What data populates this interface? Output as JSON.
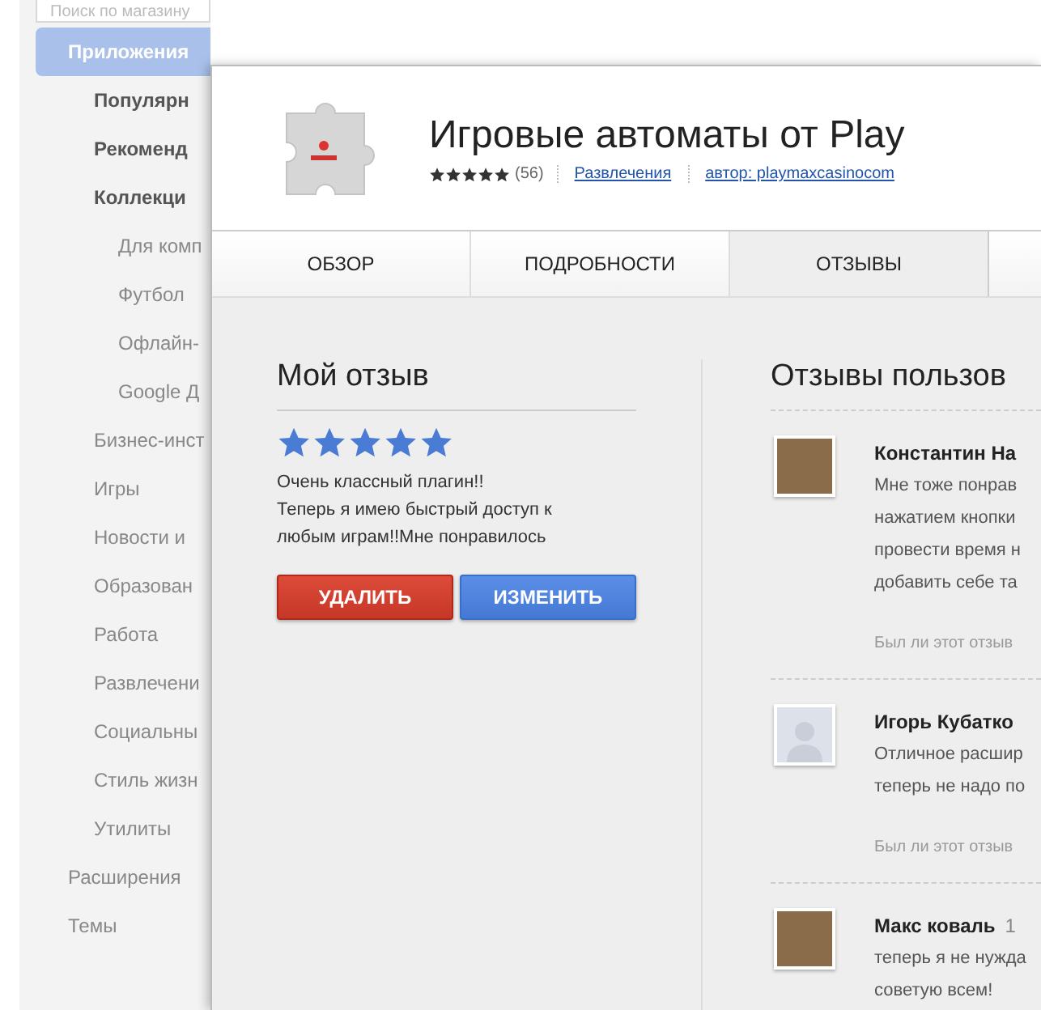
{
  "sidebar": {
    "search": {
      "placeholder": "Поиск по магазину"
    },
    "items": [
      {
        "label": "Приложения",
        "selected": true,
        "children": [
          {
            "label": "Популярн",
            "kind": "feature"
          },
          {
            "label": "Рекоменд",
            "kind": "feature"
          },
          {
            "label": "Коллекци",
            "kind": "feature",
            "children": [
              {
                "label": "Для комп"
              },
              {
                "label": "Футбол"
              },
              {
                "label": "Офлайн-"
              },
              {
                "label": "Google Д"
              }
            ]
          },
          {
            "label": "Бизнес-инст",
            "kind": "category"
          },
          {
            "label": "Игры",
            "kind": "category"
          },
          {
            "label": "Новости и",
            "kind": "category"
          },
          {
            "label": "Образован",
            "kind": "category"
          },
          {
            "label": "Работа",
            "kind": "category"
          },
          {
            "label": "Развлечени",
            "kind": "category"
          },
          {
            "label": "Социальны",
            "kind": "category"
          },
          {
            "label": "Стиль жизн",
            "kind": "category"
          },
          {
            "label": "Утилиты",
            "kind": "category"
          }
        ]
      },
      {
        "label": "Расширения",
        "selected": false
      },
      {
        "label": "Темы",
        "selected": false
      }
    ]
  },
  "dialog": {
    "title": "Игровые автоматы от Play",
    "stars": 5,
    "rating_count": "(56)",
    "category": "Развлечения",
    "author": "автор: playmaxcasinocom",
    "tabs": [
      {
        "label": "ОБЗОР",
        "selected": false
      },
      {
        "label": "ПОДРОБНОСТИ",
        "selected": false
      },
      {
        "label": "ОТЗЫВЫ",
        "selected": true
      }
    ],
    "my_review": {
      "heading": "Мой отзыв",
      "stars": 5,
      "text": [
        "Очень классный плагин!!",
        "Теперь я имею быстрый доступ к",
        "любым играм!!Мне понравилось"
      ],
      "delete_button": "УДАЛИТЬ",
      "edit_button": "ИЗМЕНИТЬ"
    },
    "user_reviews": {
      "heading": "Отзывы пользов",
      "items": [
        {
          "kind": "photo",
          "name": "Константин На",
          "lines": [
            "Мне тоже понрав",
            "нажатием кнопки",
            "провести время н",
            "добавить себе та"
          ],
          "helpful": "Был ли этот отзыв"
        },
        {
          "kind": "silhouette",
          "name": "Игорь Кубатко",
          "lines": [
            "Отличное расшир",
            "теперь не надо по"
          ],
          "helpful": "Был ли этот отзыв"
        },
        {
          "kind": "photo",
          "name": "Макс коваль",
          "date": "1",
          "lines": [
            "теперь я не нужда",
            "советую всем!"
          ]
        }
      ]
    }
  }
}
